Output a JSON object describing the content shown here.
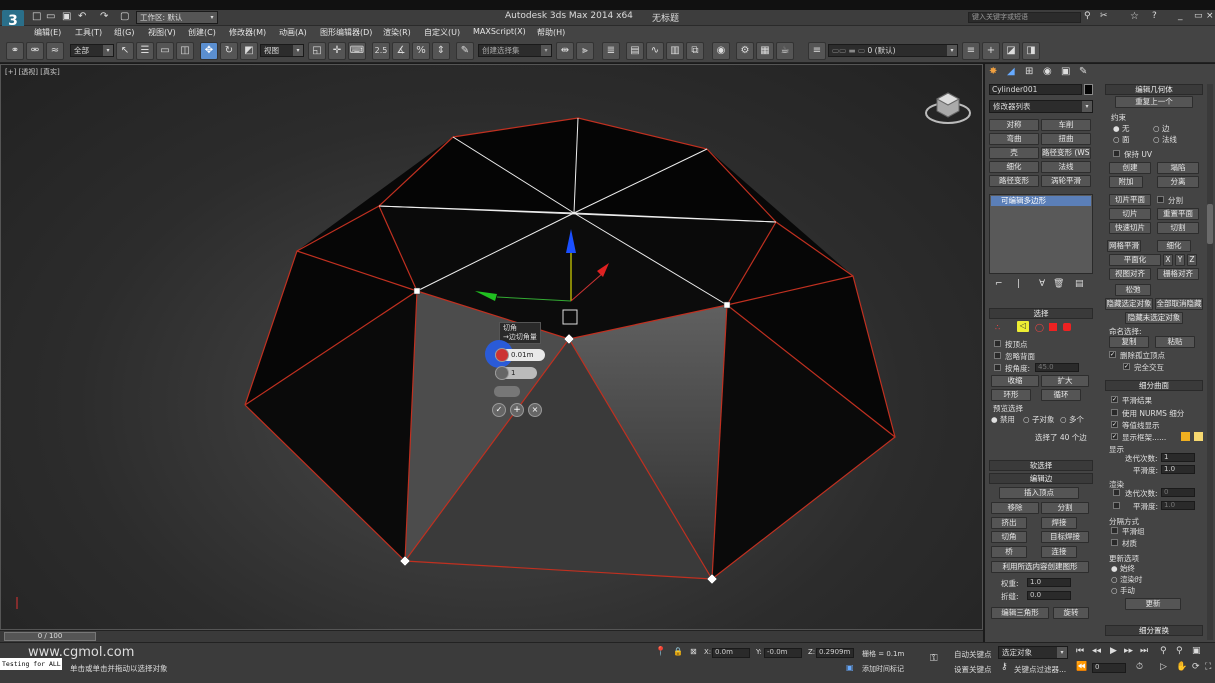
{
  "window": {
    "title": "Autodesk 3ds Max  2014 x64",
    "file_title": "无标题",
    "search_placeholder": "键入关键字或短语"
  },
  "quick_access": {
    "workspace": "工作区: 默认"
  },
  "menus": [
    "编辑(E)",
    "工具(T)",
    "组(G)",
    "视图(V)",
    "创建(C)",
    "修改器(M)",
    "动画(A)",
    "图形编辑器(D)",
    "渲染(R)",
    "自定义(U)",
    "MAXScript(X)",
    "帮助(H)"
  ],
  "toolbar": {
    "selection_filter": "全部",
    "ref_coord": "视图",
    "snap_value": "2.5",
    "named_selection": "创建选择集",
    "layer": "0 (默认)"
  },
  "viewport": {
    "label": "[+] [透视] [真实]"
  },
  "caddy": {
    "title": "切角",
    "subtitle": "→边切角量",
    "amount": "0.01m",
    "segments": "1"
  },
  "command_panel": {
    "object_name": "Cylinder001",
    "modifier_list": "修改器列表",
    "modifier_buttons": [
      "对称",
      "车削",
      "弯曲",
      "扭曲",
      "壳",
      "路径变形 (WSM)",
      "细化",
      "法线",
      "路径变形",
      "涡轮平滑"
    ],
    "stack_item": "可编辑多边形",
    "selection": {
      "header": "选择",
      "by_vertex": "按顶点",
      "ignore_backface": "忽略背面",
      "by_angle": "按角度:",
      "angle": "45.0",
      "shrink": "收缩",
      "grow": "扩大",
      "ring": "环形",
      "loop": "循环",
      "preview_label": "预览选择",
      "off": "禁用",
      "subobj": "子对象",
      "multi": "多个",
      "status": "选择了 40 个边"
    },
    "soft_selection": "软选择",
    "edit_edges": {
      "header": "编辑边",
      "insert_vertex": "插入顶点",
      "remove": "移除",
      "split": "分割",
      "extrude": "挤出",
      "weld": "焊接",
      "chamfer": "切角",
      "target_weld": "目标焊接",
      "bridge": "桥",
      "connect": "连接",
      "create_shape": "利用所选内容创建图形",
      "weight": "权重:",
      "weight_val": "1.0",
      "crease": "折缝:",
      "crease_val": "0.0",
      "edit_tri": "编辑三角形",
      "turn": "旋转"
    },
    "edit_geometry": {
      "header": "编辑几何体",
      "repeat": "重复上一个",
      "constraints": "约束",
      "none": "无",
      "edge": "边",
      "face": "面",
      "normal": "法线",
      "preserve_uv": "保持 UV",
      "create": "创建",
      "collapse": "塌陷",
      "attach": "附加",
      "detach": "分离",
      "slice_plane": "切片平面",
      "split": "分割",
      "slice": "切片",
      "reset_plane": "重置平面",
      "quickslice": "快速切片",
      "cut": "切割",
      "meshsmooth": "网格平滑",
      "tessellate": "细化",
      "planarize": "平面化",
      "x": "X",
      "y": "Y",
      "z": "Z",
      "view_align": "视图对齐",
      "grid_align": "栅格对齐",
      "relax": "松弛",
      "hide_sel": "隐藏选定对象",
      "unhide_all": "全部取消隐藏",
      "hide_unsel": "隐藏未选定对象",
      "named_sel": "命名选择:",
      "copy": "复制",
      "paste": "粘贴",
      "delete_iso": "删除孤立顶点",
      "full_inter": "完全交互"
    },
    "subdivision": {
      "header": "细分曲面",
      "smooth_result": "平滑结果",
      "use_nurms": "使用 NURMS 细分",
      "isoline": "等值线显示",
      "show_cage": "显示框架......",
      "display": "显示",
      "iterations": "迭代次数:",
      "iter_val": "1",
      "smoothness": "平滑度:",
      "smooth_val": "1.0",
      "render": "渲染",
      "r_iter_val": "0",
      "r_smooth_val": "1.0",
      "sep": "分隔方式",
      "smoothing_groups": "平滑组",
      "materials": "材质",
      "update": "更新选项",
      "always": "始终",
      "when_render": "渲染时",
      "manually": "手动",
      "update_btn": "更新"
    },
    "subdiv_displacement": "细分置换"
  },
  "timeline": {
    "frame": "0 / 100"
  },
  "status": {
    "prompt": "单击或单击并拖动以选择对象",
    "x": "0.0m",
    "y": "-0.0m",
    "z": "0.2909m",
    "grid": "栅格 = 0.1m",
    "autokey": "自动关键点",
    "selected": "选定对象",
    "set_key": "设置关键点",
    "key_filters": "关键点过滤器...",
    "add_tag": "添加时间标记",
    "frame": "0",
    "listener": "Testing for ALL"
  },
  "watermark": "www.cgmol.com",
  "colors": {
    "accent": "#5b8fd0",
    "edge_red": "#c03020",
    "caddy_blue": "#2a5bd8"
  }
}
